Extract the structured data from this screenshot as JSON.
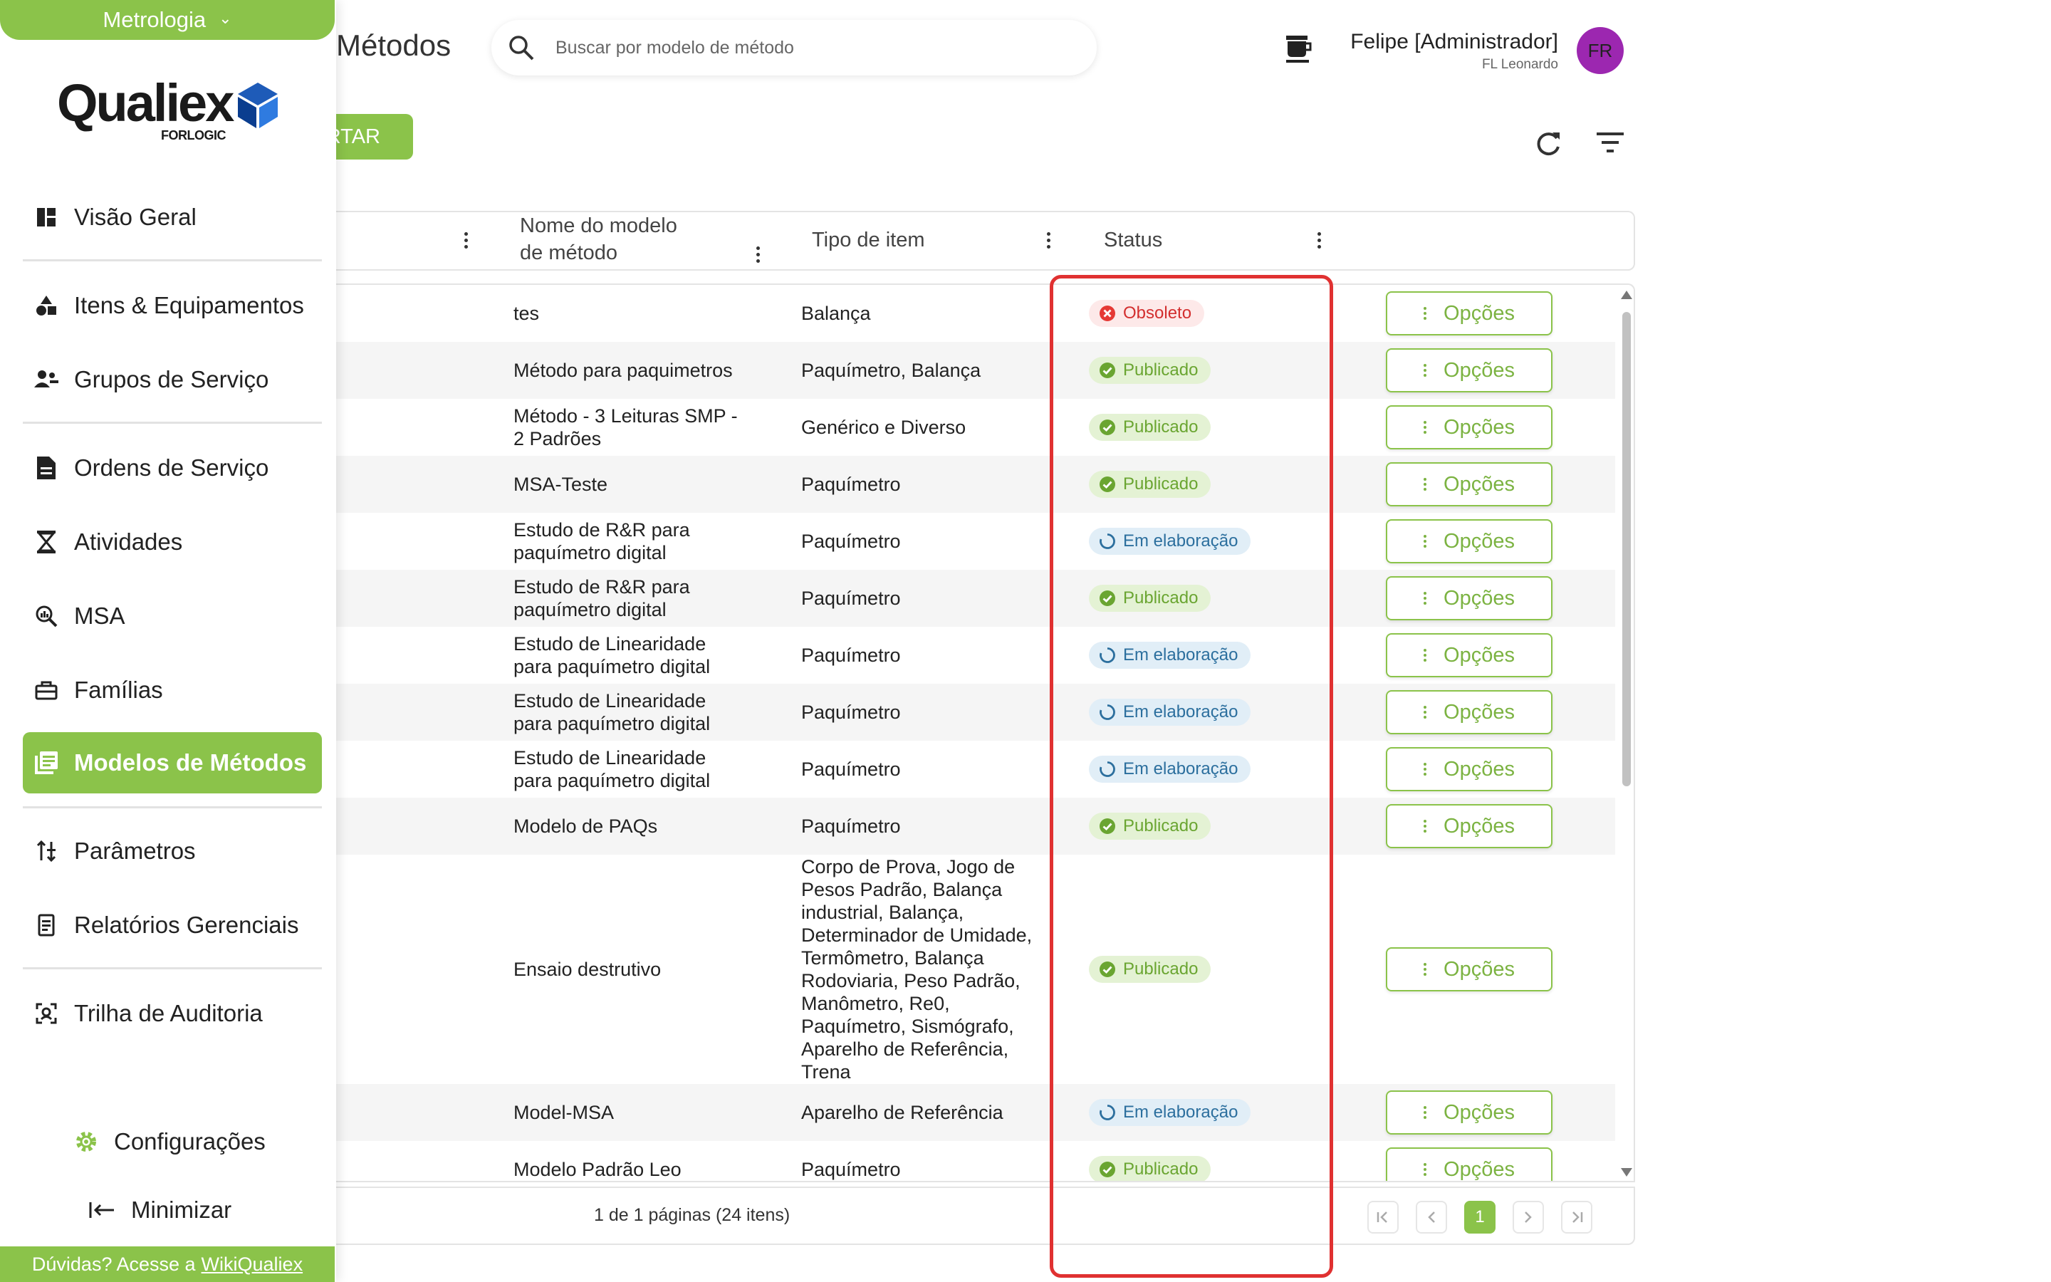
{
  "module": {
    "label": "Metrologia"
  },
  "logo": {
    "name": "Qualiex",
    "sub": "FORLOGIC"
  },
  "nav": {
    "items": [
      {
        "label": "Visão Geral"
      },
      {
        "label": "Itens & Equipamentos"
      },
      {
        "label": "Grupos de Serviço"
      },
      {
        "label": "Ordens de Serviço"
      },
      {
        "label": "Atividades"
      },
      {
        "label": "MSA"
      },
      {
        "label": "Famílias"
      },
      {
        "label": "Modelos de Métodos"
      },
      {
        "label": "Parâmetros"
      },
      {
        "label": "Relatórios Gerenciais"
      },
      {
        "label": "Trilha de Auditoria"
      }
    ],
    "active": "Modelos de Métodos",
    "settings_label": "Configurações",
    "minimize_label": "Minimizar"
  },
  "help": {
    "prefix": "Dúvidas? Acesse a",
    "link": "WikiQualiex"
  },
  "header": {
    "title": "Métodos",
    "search_placeholder": "Buscar por modelo de método",
    "user_name": "Felipe [Administrador]",
    "user_org": "FL Leonardo",
    "avatar_initials": "FR",
    "import_label": "RTAR"
  },
  "table": {
    "columns": {
      "name_line1": "Nome do modelo",
      "name_line2": "de método",
      "type": "Tipo de item",
      "status": "Status"
    },
    "options_label": "Opções",
    "rows": [
      {
        "name": "tes",
        "type": "Balança",
        "status": "Obsoleto"
      },
      {
        "name": "Método para paquimetros",
        "type": "Paquímetro, Balança",
        "status": "Publicado"
      },
      {
        "name": "Método - 3 Leituras SMP - 2 Padrões",
        "type": "Genérico e Diverso",
        "status": "Publicado"
      },
      {
        "name": "MSA-Teste",
        "type": "Paquímetro",
        "status": "Publicado"
      },
      {
        "name": "Estudo de R&R para paquímetro digital",
        "type": "Paquímetro",
        "status": "Em elaboração"
      },
      {
        "name": "Estudo de R&R para paquímetro digital",
        "type": "Paquímetro",
        "status": "Publicado"
      },
      {
        "name": "Estudo de Linearidade para paquímetro digital",
        "type": "Paquímetro",
        "status": "Em elaboração"
      },
      {
        "name": "Estudo de Linearidade para paquímetro digital",
        "type": "Paquímetro",
        "status": "Em elaboração"
      },
      {
        "name": "Estudo de Linearidade para paquímetro digital",
        "type": "Paquímetro",
        "status": "Em elaboração"
      },
      {
        "name": "Modelo de PAQs",
        "type": "Paquímetro",
        "status": "Publicado"
      },
      {
        "name": "Ensaio destrutivo",
        "type": "Corpo de Prova, Jogo de Pesos Padrão, Balança industrial, Balança, Determinador de Umidade, Termômetro, Balança Rodoviaria, Peso Padrão, Manômetro, Re0, Paquímetro, Sismógrafo, Aparelho de Referência, Trena",
        "status": "Publicado"
      },
      {
        "name": "Model-MSA",
        "type": "Aparelho de Referência",
        "status": "Em elaboração"
      },
      {
        "name": "Modelo Padrão Leo",
        "type": "Paquímetro",
        "status": "Publicado"
      }
    ]
  },
  "pagination": {
    "info": "1 de 1 páginas (24 itens)",
    "current": "1"
  },
  "colors": {
    "accent": "#8bc34a",
    "highlight": "#e03131",
    "avatar": "#9c27b0"
  }
}
